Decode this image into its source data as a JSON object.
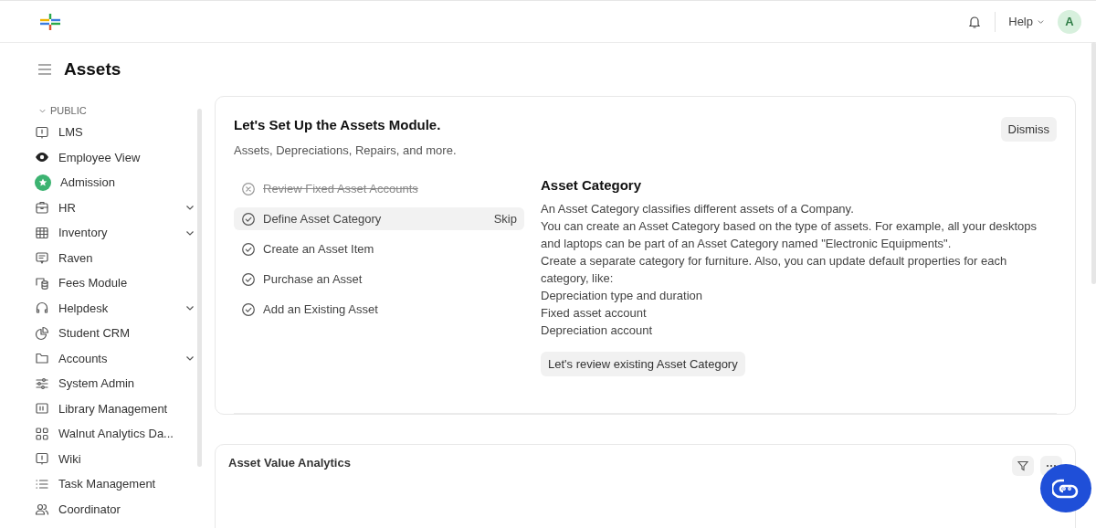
{
  "header": {
    "help": "Help",
    "avatar": "A"
  },
  "page": {
    "title": "Assets"
  },
  "sidebar": {
    "section": "PUBLIC",
    "items": [
      {
        "label": "LMS",
        "collapsible": false
      },
      {
        "label": "Employee View",
        "collapsible": false
      },
      {
        "label": "Admission",
        "collapsible": false
      },
      {
        "label": "HR",
        "collapsible": true
      },
      {
        "label": "Inventory",
        "collapsible": true
      },
      {
        "label": "Raven",
        "collapsible": false
      },
      {
        "label": "Fees Module",
        "collapsible": false
      },
      {
        "label": "Helpdesk",
        "collapsible": true
      },
      {
        "label": "Student CRM",
        "collapsible": false
      },
      {
        "label": "Accounts",
        "collapsible": true
      },
      {
        "label": "System Admin",
        "collapsible": false
      },
      {
        "label": "Library Management",
        "collapsible": false
      },
      {
        "label": "Walnut Analytics Da...",
        "collapsible": false
      },
      {
        "label": "Wiki",
        "collapsible": false
      },
      {
        "label": "Task Management",
        "collapsible": false
      },
      {
        "label": "Coordinator",
        "collapsible": false
      }
    ]
  },
  "onboarding": {
    "title": "Let's Set Up the Assets Module.",
    "subtitle": "Assets, Depreciations, Repairs, and more.",
    "dismiss": "Dismiss",
    "steps": [
      {
        "label": "Review Fixed Asset Accounts",
        "done": true,
        "selected": false
      },
      {
        "label": "Define Asset Category",
        "done": false,
        "selected": true,
        "action": "Skip"
      },
      {
        "label": "Create an Asset Item",
        "done": false,
        "selected": false
      },
      {
        "label": "Purchase an Asset",
        "done": false,
        "selected": false
      },
      {
        "label": "Add an Existing Asset",
        "done": false,
        "selected": false
      }
    ],
    "detail": {
      "title": "Asset Category",
      "lines": [
        "An Asset Category classifies different assets of a Company.",
        "You can create an Asset Category based on the type of assets. For example, all your desktops and laptops can be part of an Asset Category named \"Electronic Equipments\".",
        "Create a separate category for furniture. Also, you can update default properties for each category, like:",
        "Depreciation type and duration",
        "Fixed asset account",
        "Depreciation account"
      ],
      "button": "Let's review existing Asset Category"
    }
  },
  "chart_card": {
    "title": "Asset Value Analytics"
  }
}
